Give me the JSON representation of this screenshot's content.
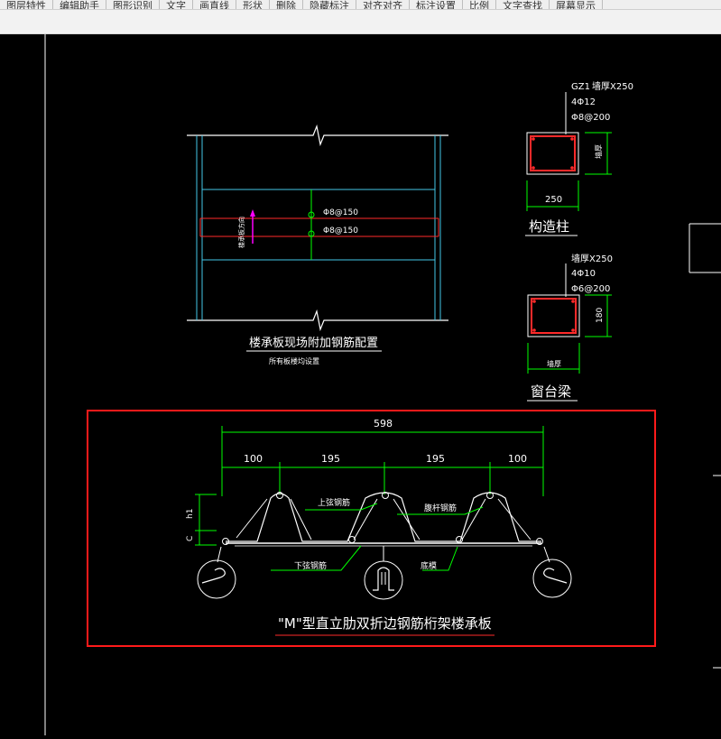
{
  "toolbar": {
    "items": [
      "图层特性",
      "编辑助手",
      "图形识别",
      "文字",
      "画直线",
      "形状",
      "删除",
      "隐藏标注",
      "对齐对齐",
      "标注设置",
      "比例",
      "文字查找",
      "屏幕显示"
    ]
  },
  "drawing": {
    "slab_detail": {
      "label_top": "Φ8@150",
      "label_bottom": "Φ8@150",
      "vertical_note": "楼承板方向",
      "title": "楼承板现场附加钢筋配置",
      "subtitle": "所有板楼均设置"
    },
    "column": {
      "code": "GZ1",
      "size": "墙厚X250",
      "rebar_main": "4Φ12",
      "stirrup": "Φ8@200",
      "dim_width": "250",
      "dim_side": "墙厚",
      "title": "构造柱"
    },
    "beam": {
      "size": "墙厚X250",
      "rebar_main": "4Φ10",
      "stirrup": "Φ6@200",
      "dim_side": "180",
      "dim_width": "墙厚",
      "title": "窗台梁"
    },
    "truss_deck": {
      "total_width": "598",
      "segments": [
        "100",
        "195",
        "195",
        "100"
      ],
      "label_h1": "h1",
      "label_c": "C",
      "top_chord": "上弦钢筋",
      "web_bar": "腹杆钢筋",
      "bottom_chord": "下弦钢筋",
      "base_plate": "底模",
      "title": "\"M\"型直立肋双折边钢筋桁架楼承板"
    }
  },
  "colors": {
    "background": "#000000",
    "line_white": "#ffffff",
    "dim_green": "#00ff00",
    "rebar_red": "#ff2a2a",
    "highlight_red": "#ff1a1a",
    "cyan": "#44c8e8",
    "magenta": "#ff00ff"
  }
}
